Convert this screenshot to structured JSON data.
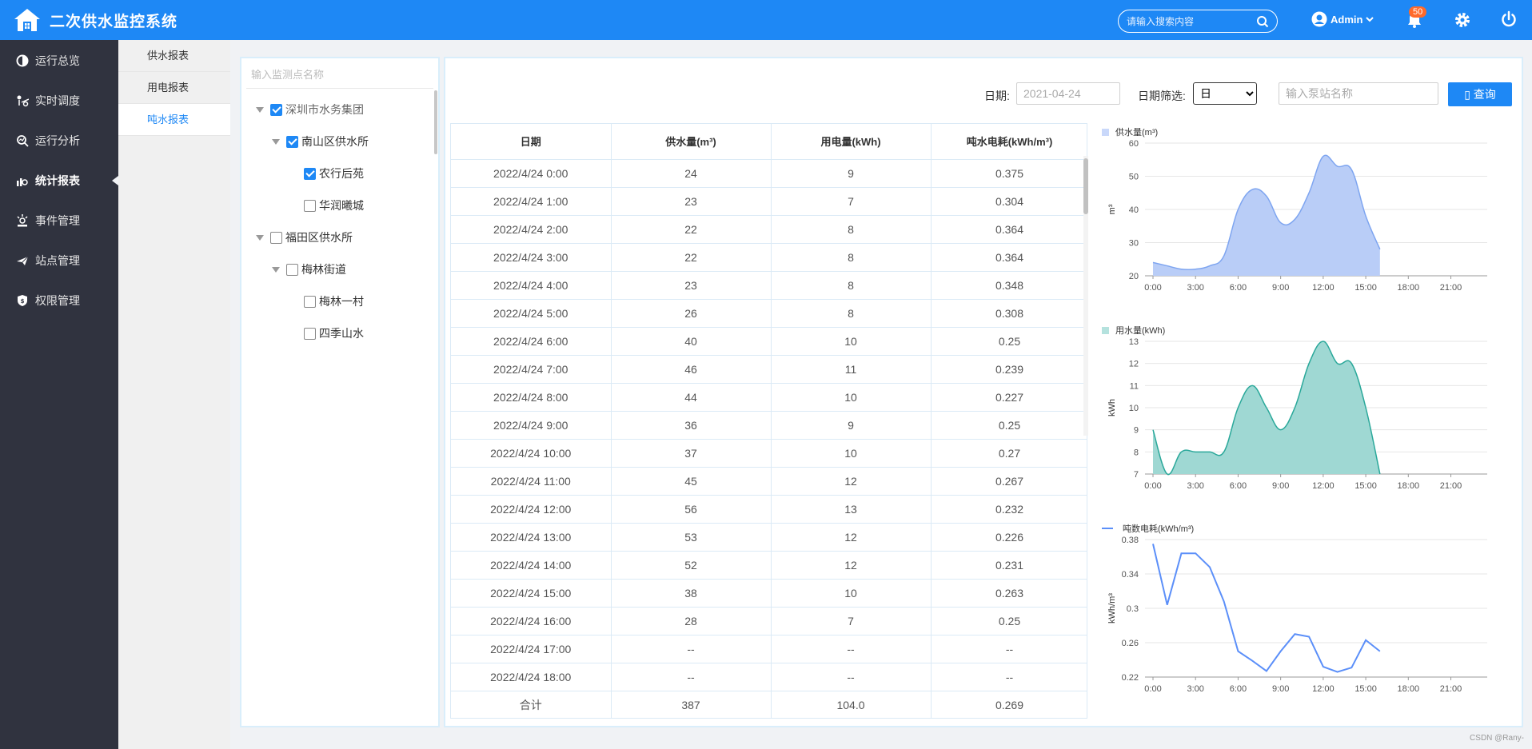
{
  "app": {
    "title": "二次供水监控系统"
  },
  "header": {
    "search_placeholder": "请输入搜索内容",
    "user": "Admin",
    "notifications": "50"
  },
  "sidebar": {
    "items": [
      {
        "label": "运行总览",
        "icon": "pie-icon"
      },
      {
        "label": "实时调度",
        "icon": "dispatch-icon"
      },
      {
        "label": "运行分析",
        "icon": "analysis-icon"
      },
      {
        "label": "统计报表",
        "icon": "bar-chart-icon",
        "active": true
      },
      {
        "label": "事件管理",
        "icon": "event-icon"
      },
      {
        "label": "站点管理",
        "icon": "plane-icon"
      },
      {
        "label": "权限管理",
        "icon": "shield-icon"
      }
    ]
  },
  "submenu": {
    "items": [
      {
        "label": "供水报表"
      },
      {
        "label": "用电报表"
      },
      {
        "label": "吨水报表",
        "active": true
      }
    ]
  },
  "tree": {
    "search_placeholder": "输入监测点名称",
    "nodes": [
      {
        "label": "深圳市水务集团",
        "checked": true
      },
      {
        "label": "南山区供水所",
        "checked": true
      },
      {
        "label": "农行后苑",
        "checked": true
      },
      {
        "label": "华润曦城",
        "checked": false
      },
      {
        "label": "福田区供水所",
        "checked": false
      },
      {
        "label": "梅林街道",
        "checked": false
      },
      {
        "label": "梅林一村",
        "checked": false
      },
      {
        "label": "四季山水",
        "checked": false
      }
    ]
  },
  "filters": {
    "date_label": "日期:",
    "date_placeholder": "2021-04-24",
    "period_label": "日期筛选:",
    "period_value": "日",
    "pump_placeholder": "输入泵站名称",
    "query_label": "▯ 查询"
  },
  "table": {
    "headers": [
      "日期",
      "供水量(m³)",
      "用电量(kWh)",
      "吨水电耗(kWh/m³)"
    ],
    "rows": [
      [
        "2022/4/24 0:00",
        "24",
        "9",
        "0.375"
      ],
      [
        "2022/4/24 1:00",
        "23",
        "7",
        "0.304"
      ],
      [
        "2022/4/24 2:00",
        "22",
        "8",
        "0.364"
      ],
      [
        "2022/4/24 3:00",
        "22",
        "8",
        "0.364"
      ],
      [
        "2022/4/24 4:00",
        "23",
        "8",
        "0.348"
      ],
      [
        "2022/4/24 5:00",
        "26",
        "8",
        "0.308"
      ],
      [
        "2022/4/24 6:00",
        "40",
        "10",
        "0.25"
      ],
      [
        "2022/4/24 7:00",
        "46",
        "11",
        "0.239"
      ],
      [
        "2022/4/24 8:00",
        "44",
        "10",
        "0.227"
      ],
      [
        "2022/4/24 9:00",
        "36",
        "9",
        "0.25"
      ],
      [
        "2022/4/24 10:00",
        "37",
        "10",
        "0.27"
      ],
      [
        "2022/4/24 11:00",
        "45",
        "12",
        "0.267"
      ],
      [
        "2022/4/24 12:00",
        "56",
        "13",
        "0.232"
      ],
      [
        "2022/4/24 13:00",
        "53",
        "12",
        "0.226"
      ],
      [
        "2022/4/24 14:00",
        "52",
        "12",
        "0.231"
      ],
      [
        "2022/4/24 15:00",
        "38",
        "10",
        "0.263"
      ],
      [
        "2022/4/24 16:00",
        "28",
        "7",
        "0.25"
      ],
      [
        "2022/4/24 17:00",
        "--",
        "--",
        "--"
      ],
      [
        "2022/4/24 18:00",
        "--",
        "--",
        "--"
      ]
    ],
    "total": [
      "合计",
      "387",
      "104.0",
      "0.269"
    ]
  },
  "chart_data": [
    {
      "type": "area",
      "legend": "供水量(m³)",
      "ylabel": "m³",
      "color": "#b9cdf7",
      "stroke": "#7ea5f0",
      "x": [
        "0:00",
        "1:00",
        "2:00",
        "3:00",
        "4:00",
        "5:00",
        "6:00",
        "7:00",
        "8:00",
        "9:00",
        "10:00",
        "11:00",
        "12:00",
        "13:00",
        "14:00",
        "15:00",
        "16:00"
      ],
      "values": [
        24,
        23,
        22,
        22,
        23,
        26,
        40,
        46,
        44,
        36,
        37,
        45,
        56,
        53,
        52,
        38,
        28
      ],
      "ylim": [
        20,
        60
      ],
      "yticks": [
        "20",
        "30",
        "40",
        "50",
        "60"
      ],
      "xticks": [
        "0:00",
        "3:00",
        "6:00",
        "9:00",
        "12:00",
        "15:00",
        "18:00",
        "21:00"
      ]
    },
    {
      "type": "area",
      "legend": "用水量(kWh)",
      "ylabel": "kWh",
      "color": "#9fd8d3",
      "stroke": "#2aa89a",
      "x": [
        "0:00",
        "1:00",
        "2:00",
        "3:00",
        "4:00",
        "5:00",
        "6:00",
        "7:00",
        "8:00",
        "9:00",
        "10:00",
        "11:00",
        "12:00",
        "13:00",
        "14:00",
        "15:00",
        "16:00"
      ],
      "values": [
        9,
        7,
        8,
        8,
        8,
        8,
        10,
        11,
        10,
        9,
        10,
        12,
        13,
        12,
        12,
        10,
        7
      ],
      "ylim": [
        7,
        13
      ],
      "yticks": [
        "7",
        "8",
        "9",
        "10",
        "11",
        "12",
        "13"
      ],
      "xticks": [
        "0:00",
        "3:00",
        "6:00",
        "9:00",
        "12:00",
        "15:00",
        "18:00",
        "21:00"
      ]
    },
    {
      "type": "line",
      "legend": "吨数电耗(kWh/m³)",
      "ylabel": "kWh/m³",
      "color": "#5b8ff9",
      "x": [
        "0:00",
        "1:00",
        "2:00",
        "3:00",
        "4:00",
        "5:00",
        "6:00",
        "7:00",
        "8:00",
        "9:00",
        "10:00",
        "11:00",
        "12:00",
        "13:00",
        "14:00",
        "15:00",
        "16:00"
      ],
      "values": [
        0.375,
        0.304,
        0.364,
        0.364,
        0.348,
        0.308,
        0.25,
        0.239,
        0.227,
        0.25,
        0.27,
        0.267,
        0.232,
        0.226,
        0.231,
        0.263,
        0.25
      ],
      "ylim": [
        0.22,
        0.38
      ],
      "yticks": [
        "0.22",
        "0.26",
        "0.3",
        "0.34",
        "0.38"
      ],
      "xticks": [
        "0:00",
        "3:00",
        "6:00",
        "9:00",
        "12:00",
        "15:00",
        "18:00",
        "21:00"
      ]
    }
  ],
  "watermark": "CSDN @Rany-"
}
